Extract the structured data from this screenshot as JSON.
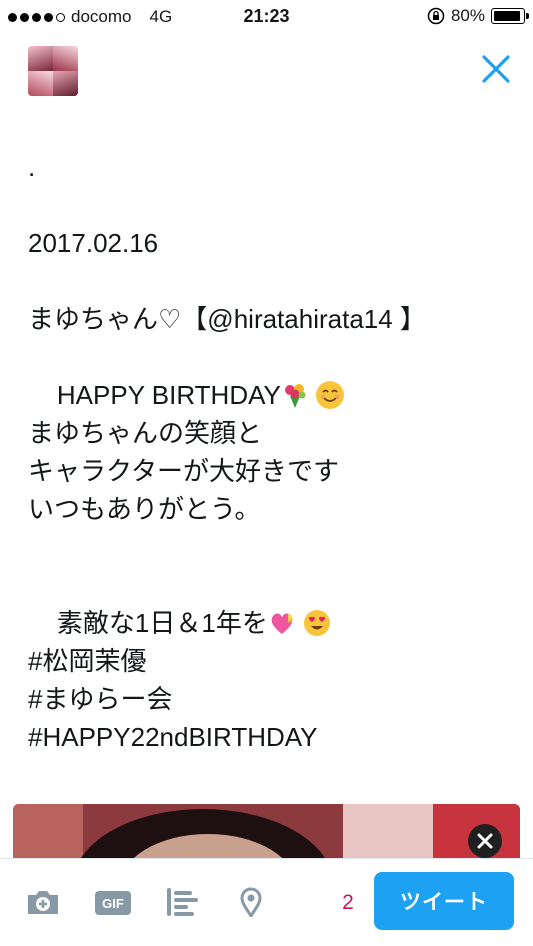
{
  "status_bar": {
    "carrier": "docomo",
    "network": "4G",
    "time": "21:23",
    "battery": "80%"
  },
  "tweet_text": {
    "l1": ".",
    "l2": "2017.02.16",
    "l3": "まゆちゃん♡【@hiratahirata14 】",
    "l4": "HAPPY BIRTHDAY",
    "l5": "まゆちゃんの笑顔と",
    "l6": "キャラクターが大好きです",
    "l7": "いつもありがとう。",
    "l8": "素敵な1日＆1年を",
    "l9": "#松岡茉優",
    "l10": "#まゆらー会",
    "l11": "#HAPPY22ndBIRTHDAY"
  },
  "toolbar": {
    "gif_label": "GIF",
    "remaining_count": "2",
    "tweet_label": "ツイート"
  },
  "icons": [
    "camera-icon",
    "gif-icon",
    "poll-icon",
    "location-icon",
    "close-icon",
    "remove-icon",
    "bouquet-emoji",
    "smile-emoji",
    "heart-emoji",
    "heart-eyes-emoji"
  ],
  "colors": {
    "accent": "#1da1f2",
    "counter": "#c2185b"
  }
}
